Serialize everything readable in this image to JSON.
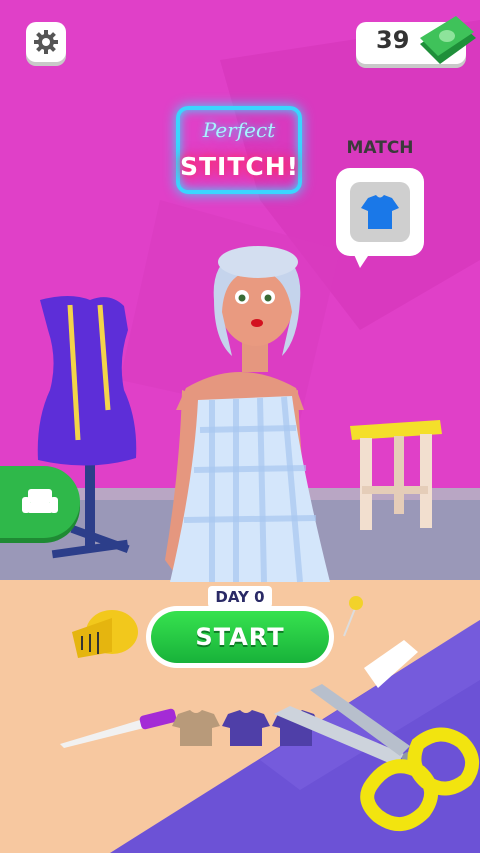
{
  "hud": {
    "currency_value": "39"
  },
  "sign": {
    "script_text": "Perfect",
    "main_text": "STITCH!"
  },
  "match": {
    "label": "MATCH",
    "icon": "shirt-icon"
  },
  "menu": {
    "day_label": "DAY 0",
    "start_label": "START"
  },
  "progress": {
    "outfits_total": 3,
    "outfits_done": 0
  },
  "colors": {
    "wall": "#e040c8",
    "floor": "#f7c8a0",
    "mat": "#6c52d6",
    "start_button": "#22c443",
    "decor_button": "#2fb84a",
    "dress_form": "#5d2ed8",
    "shirt_icon": "#1a78e8"
  },
  "icons": {
    "settings": "gear-icon",
    "currency": "money-icon",
    "decor": "sofa-icon"
  }
}
